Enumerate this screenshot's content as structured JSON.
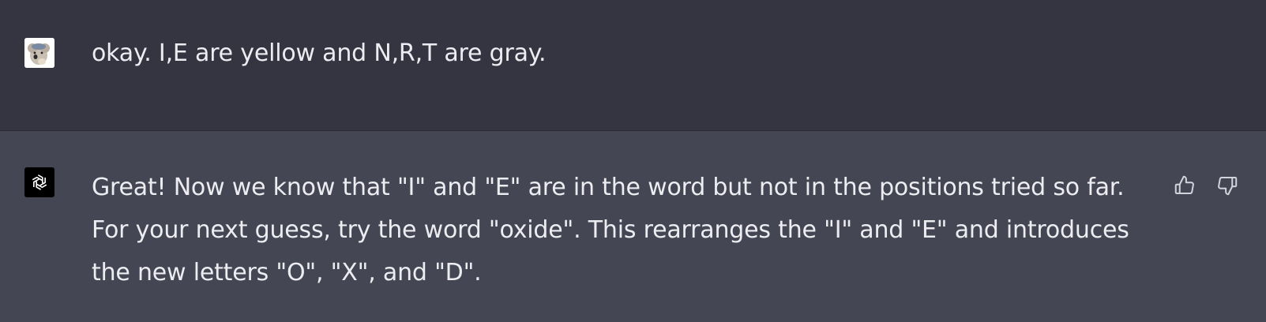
{
  "conversation": {
    "messages": [
      {
        "role": "user",
        "text": "okay. I,E are yellow and N,R,T are gray."
      },
      {
        "role": "assistant",
        "text": "Great! Now we know that \"I\" and \"E\" are in the word but not in the positions tried so far. For your next guess, try the word \"oxide\". This rearranges the \"I\" and \"E\" and introduces the new letters \"O\", \"X\", and \"D\"."
      }
    ]
  },
  "icons": {
    "user_avatar": "user-avatar-koala",
    "assistant_avatar": "openai-logo-icon",
    "thumbs_up": "thumbs-up-icon",
    "thumbs_down": "thumbs-down-icon"
  },
  "colors": {
    "user_bg": "#343541",
    "assistant_bg": "#444654",
    "text": "#ececf1",
    "icon": "#d1d5db"
  }
}
